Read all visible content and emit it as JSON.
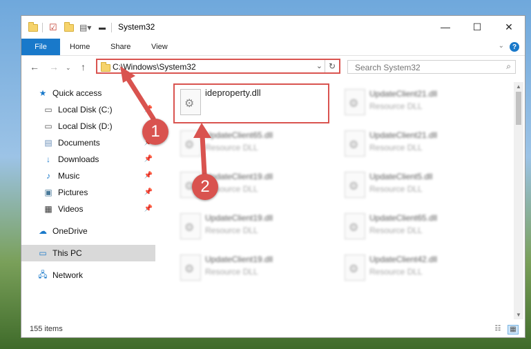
{
  "window": {
    "title": "System32",
    "controls": {
      "minimize": "—",
      "maximize": "☐",
      "close": "✕"
    }
  },
  "ribbon": {
    "tabs": [
      {
        "label": "File"
      },
      {
        "label": "Home"
      },
      {
        "label": "Share"
      },
      {
        "label": "View"
      }
    ],
    "help": "?"
  },
  "address": {
    "path": "C:\\Windows\\System32"
  },
  "search": {
    "placeholder": "Search System32"
  },
  "sidebar": {
    "items": [
      {
        "label": "Quick access",
        "icon": "star-icon",
        "pinned": false,
        "selected": false
      },
      {
        "label": "Local Disk (C:)",
        "icon": "drive-icon",
        "pinned": true,
        "selected": false
      },
      {
        "label": "Local Disk (D:)",
        "icon": "drive-icon",
        "pinned": true,
        "selected": false
      },
      {
        "label": "Documents",
        "icon": "document-icon",
        "pinned": true,
        "selected": false
      },
      {
        "label": "Downloads",
        "icon": "download-icon",
        "pinned": true,
        "selected": false
      },
      {
        "label": "Music",
        "icon": "music-icon",
        "pinned": true,
        "selected": false
      },
      {
        "label": "Pictures",
        "icon": "pictures-icon",
        "pinned": true,
        "selected": false
      },
      {
        "label": "Videos",
        "icon": "video-icon",
        "pinned": true,
        "selected": false
      },
      {
        "label": "OneDrive",
        "icon": "cloud-icon",
        "pinned": false,
        "selected": false
      },
      {
        "label": "This PC",
        "icon": "computer-icon",
        "pinned": false,
        "selected": true
      },
      {
        "label": "Network",
        "icon": "network-icon",
        "pinned": false,
        "selected": false
      }
    ]
  },
  "files": [
    {
      "name": "ideproperty.dll",
      "type": "",
      "highlighted": true
    },
    {
      "name": "UpdateClient21.dll",
      "type": "Resource DLL",
      "highlighted": false
    },
    {
      "name": "UpdateClient65.dll",
      "type": "Resource DLL",
      "highlighted": false
    },
    {
      "name": "UpdateClient21.dll",
      "type": "Resource DLL",
      "highlighted": false
    },
    {
      "name": "UpdateClient19.dll",
      "type": "Resource DLL",
      "highlighted": false
    },
    {
      "name": "UpdateClient5.dll",
      "type": "Resource DLL",
      "highlighted": false
    },
    {
      "name": "UpdateClient19.dll",
      "type": "Resource DLL",
      "highlighted": false
    },
    {
      "name": "UpdateClient65.dll",
      "type": "Resource DLL",
      "highlighted": false
    },
    {
      "name": "UpdateClient19.dll",
      "type": "Resource DLL",
      "highlighted": false
    },
    {
      "name": "UpdateClient42.dll",
      "type": "Resource DLL",
      "highlighted": false
    }
  ],
  "status": {
    "item_count": "155 items"
  },
  "annotations": {
    "step1": "1",
    "step2": "2"
  },
  "colors": {
    "accent": "#1979ca",
    "highlight": "#d9534f",
    "selection": "#d9d9d9"
  }
}
